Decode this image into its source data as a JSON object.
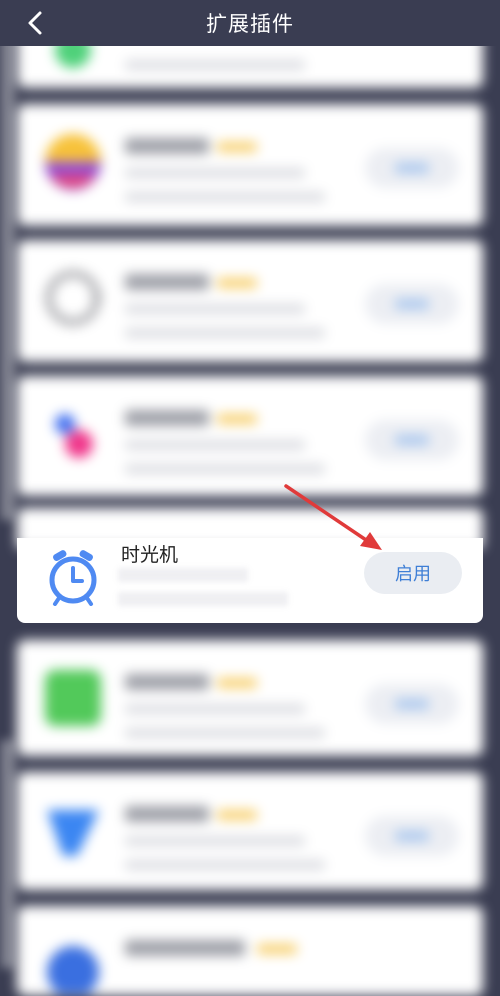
{
  "header": {
    "title": "扩展插件",
    "back_icon": "chevron-left-icon"
  },
  "focus_plugin": {
    "name": "时光机",
    "button_label": "启用",
    "icon": "alarm-clock-icon"
  },
  "annotation": {
    "icon": "red-arrow-icon",
    "color": "#e03a3a"
  },
  "colors": {
    "background": "#3a3d52",
    "accent_blue": "#3f7fd6",
    "button_bg": "#eaedf2",
    "clock_blue": "#4f8af2"
  }
}
